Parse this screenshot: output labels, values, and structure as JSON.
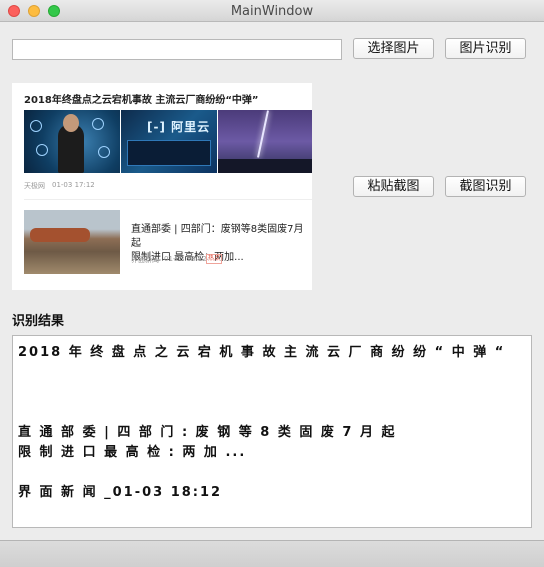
{
  "window": {
    "title": "MainWindow"
  },
  "toolbar": {
    "path_value": "",
    "select_image_label": "选择图片",
    "recognize_image_label": "图片识别",
    "paste_screenshot_label": "粘贴截图",
    "recognize_screenshot_label": "截图识别"
  },
  "preview": {
    "headline": "2018年终盘点之云宕机事故 主流云厂商纷纷“中弹”",
    "image2_logo": "[-] 阿里云",
    "source1": "天极网",
    "time1": "01-03 17:12",
    "article2_line1": "直通部委 | 四部门：废钢等8类固废7月起",
    "article2_line2": "限制进口 最高检：两加...",
    "source2": "界面新闻",
    "time2": "01-03 18:12",
    "hot_badge": "热点"
  },
  "result": {
    "label": "识别结果",
    "lines": [
      "2018 年 终 盘 点 之 云 宕 机 事 故 主 流 云 厂 商 纷 纷 “ 中 弹 “",
      "",
      "",
      "",
      "直 通 部 委 | 四 部 门 : 废 钢 等 8 类 固 废 7 月 起",
      "限 制 进 口 最 高 检 : 两 加 ...",
      "",
      "界 面 新 闻 _01-03 18:12"
    ]
  }
}
